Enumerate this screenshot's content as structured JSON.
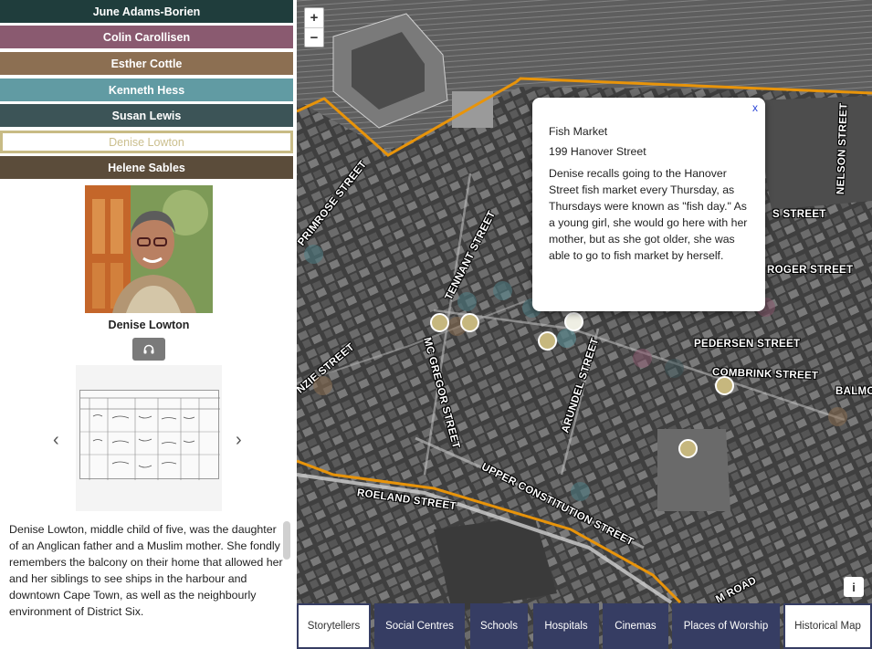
{
  "sidebar": {
    "people": [
      {
        "name": "June Adams-Borien",
        "color": "#1f3d3c"
      },
      {
        "name": "Colin Carollisen",
        "color": "#8a5a70"
      },
      {
        "name": "Esther Cottle",
        "color": "#8c6f52"
      },
      {
        "name": "Kenneth Hess",
        "color": "#619ba3"
      },
      {
        "name": "Susan Lewis",
        "color": "#3c5457"
      },
      {
        "name": "Denise Lowton",
        "color": "#c8bb85",
        "selected": true
      },
      {
        "name": "Helene Sables",
        "color": "#5b4c3a"
      }
    ],
    "selected_name": "Denise Lowton",
    "audio_icon": "headphones-icon",
    "prev_icon": "chevron-left-icon",
    "next_icon": "chevron-right-icon",
    "bio": "Denise Lowton, middle child of five, was the daughter of an Anglican father and a Muslim mother. She fondly remembers the balcony on their home that allowed her and her siblings to see ships in the harbour and downtown Cape Town, as well as the neighbourly environment of District Six."
  },
  "map": {
    "zoom_in": "+",
    "zoom_out": "−",
    "info": "i",
    "streets": [
      "PRIMROSE STREET",
      "TENNANT STREET",
      "MC GREGOR STREET",
      "ARUNDEL STREET",
      "PEDERSEN STREET",
      "COMBRINK STREET",
      "ROGER STREET",
      "NELSON STREET",
      "S STREET",
      "BALMO",
      "NZIE STREET",
      "UPPER CONSTITUTION STREET",
      "ROELAND STREET",
      "M ROAD"
    ],
    "popup": {
      "close": "x",
      "title": "Fish Market",
      "address": "199 Hanover Street",
      "text": "Denise recalls going to the Hanover Street fish market every Thursday, as Thursdays were known as \"fish day.\" As a young girl, she would go here with her mother, but as she got older, she was able to go to fish market by herself."
    }
  },
  "bottom_nav": [
    {
      "label": "Storytellers",
      "style": "light"
    },
    {
      "label": "Social Centres",
      "style": "dark"
    },
    {
      "label": "Schools",
      "style": "dark"
    },
    {
      "label": "Hospitals",
      "style": "dark"
    },
    {
      "label": "Cinemas",
      "style": "dark"
    },
    {
      "label": "Places of Worship",
      "style": "dark"
    },
    {
      "label": "Historical Map",
      "style": "light"
    }
  ]
}
